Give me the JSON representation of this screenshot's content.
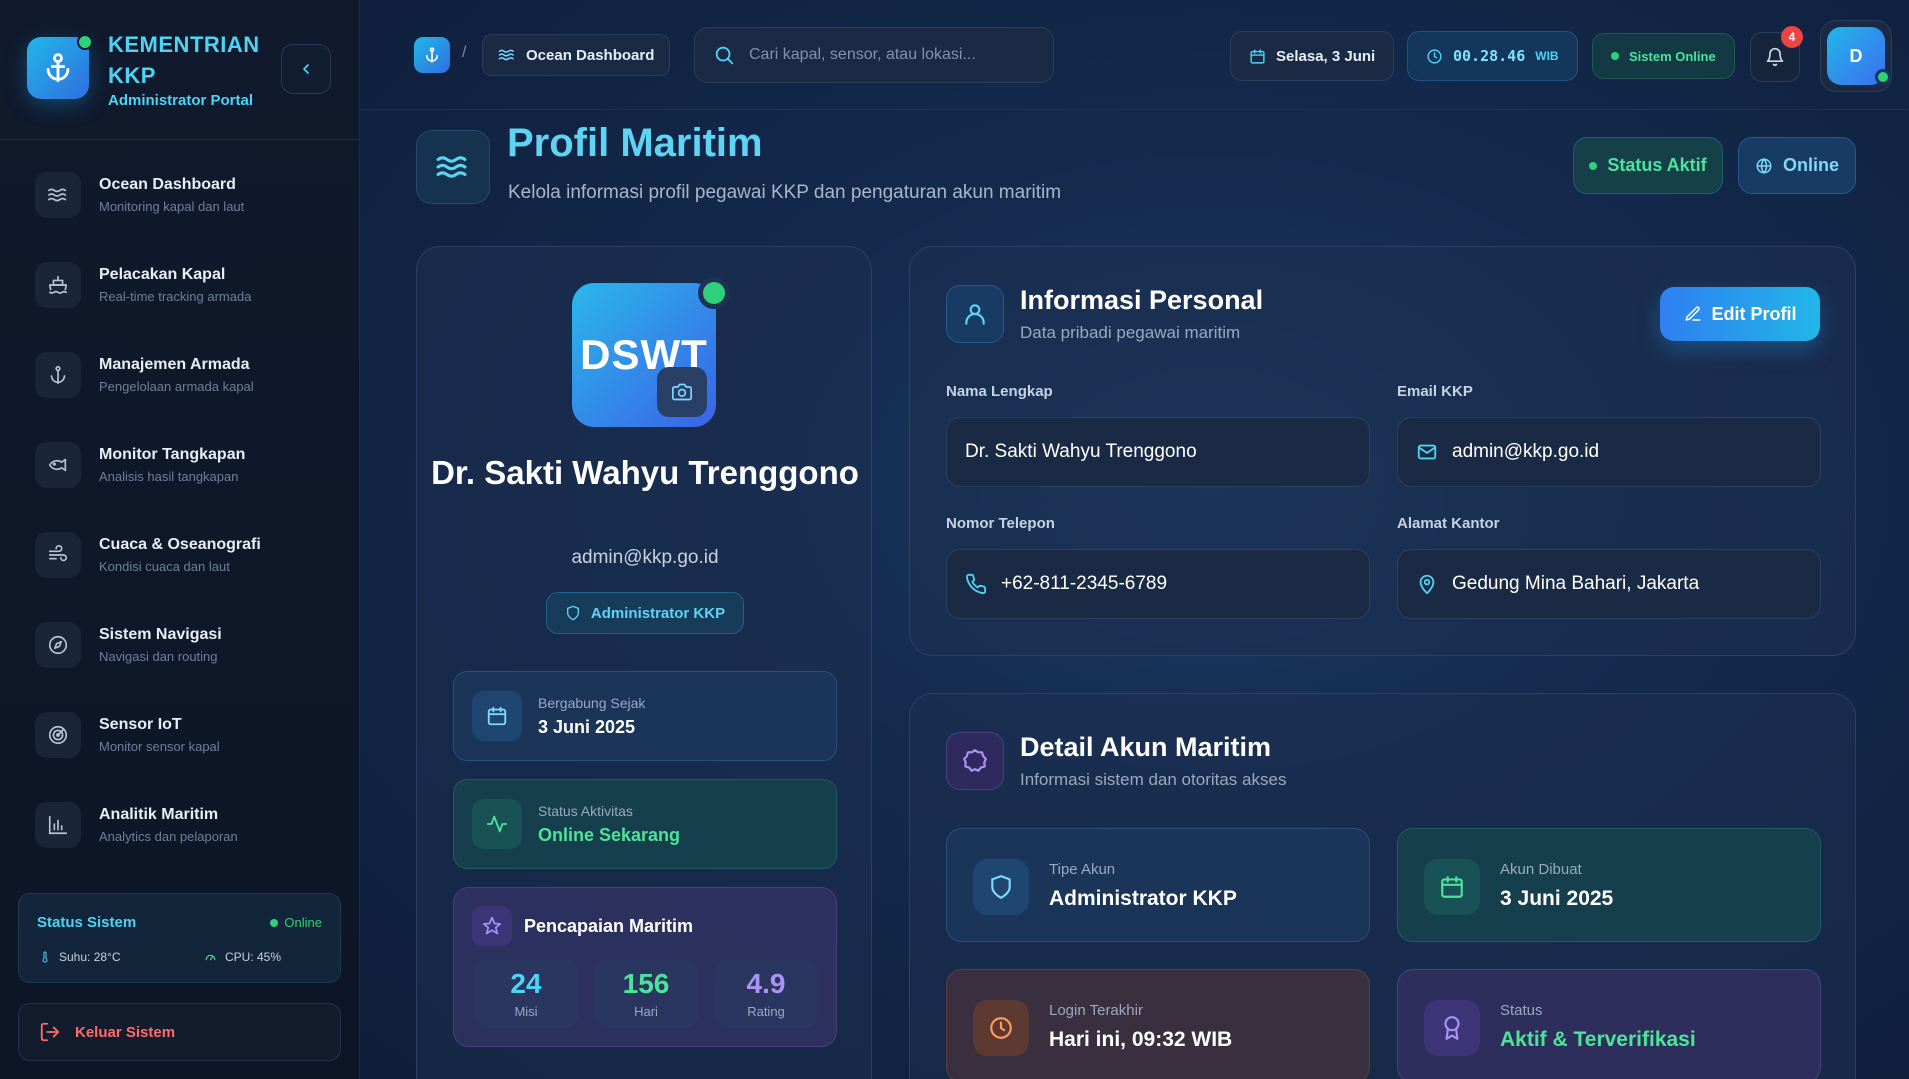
{
  "brand": {
    "title": "KEMENTRIAN KKP",
    "subtitle": "Administrator Portal"
  },
  "sidebar": {
    "items": [
      {
        "label": "Ocean Dashboard",
        "desc": "Monitoring kapal dan laut",
        "icon": "waves-icon"
      },
      {
        "label": "Pelacakan Kapal",
        "desc": "Real-time tracking armada",
        "icon": "ship-icon"
      },
      {
        "label": "Manajemen Armada",
        "desc": "Pengelolaan armada kapal",
        "icon": "anchor-icon"
      },
      {
        "label": "Monitor Tangkapan",
        "desc": "Analisis hasil tangkapan",
        "icon": "fish-icon"
      },
      {
        "label": "Cuaca & Oseanografi",
        "desc": "Kondisi cuaca dan laut",
        "icon": "wind-icon"
      },
      {
        "label": "Sistem Navigasi",
        "desc": "Navigasi dan routing",
        "icon": "compass-icon"
      },
      {
        "label": "Sensor IoT",
        "desc": "Monitor sensor kapal",
        "icon": "radar-icon"
      },
      {
        "label": "Analitik Maritim",
        "desc": "Analytics dan pelaporan",
        "icon": "bar-chart-icon"
      }
    ],
    "system_status": {
      "title": "Status Sistem",
      "state": "Online",
      "temperature": "Suhu: 28°C",
      "cpu": "CPU: 45%"
    },
    "logout_label": "Keluar Sistem"
  },
  "topbar": {
    "breadcrumb": {
      "separator": "/",
      "current": "Ocean Dashboard"
    },
    "search_placeholder": "Cari kapal, sensor, atau lokasi...",
    "date": "Selasa, 3 Juni",
    "time": "00.28.46",
    "timezone": "WIB",
    "system_status": "Sistem Online",
    "notification_count": "4",
    "user_initial": "D"
  },
  "header": {
    "title": "Profil Maritim",
    "subtitle": "Kelola informasi profil pegawai KKP dan pengaturan akun maritim",
    "status_pill": "Status Aktif",
    "online_pill": "Online"
  },
  "profile": {
    "initials": "DSWT",
    "name": "Dr. Sakti Wahyu Trenggono",
    "email": "admin@kkp.go.id",
    "role": "Administrator KKP",
    "joined_label": "Bergabung Sejak",
    "joined_value": "3 Juni 2025",
    "activity_label": "Status Aktivitas",
    "activity_value": "Online Sekarang",
    "achievements": {
      "title": "Pencapaian Maritim",
      "stats": [
        {
          "value": "24",
          "label": "Misi"
        },
        {
          "value": "156",
          "label": "Hari"
        },
        {
          "value": "4.9",
          "label": "Rating"
        }
      ]
    }
  },
  "personal": {
    "title": "Informasi Personal",
    "subtitle": "Data pribadi pegawai maritim",
    "edit_label": "Edit Profil",
    "fields": {
      "name_label": "Nama Lengkap",
      "name_value": "Dr. Sakti Wahyu Trenggono",
      "email_label": "Email KKP",
      "email_value": "admin@kkp.go.id",
      "phone_label": "Nomor Telepon",
      "phone_value": "+62-811-2345-6789",
      "address_label": "Alamat Kantor",
      "address_value": "Gedung Mina Bahari, Jakarta"
    }
  },
  "account": {
    "title": "Detail Akun Maritim",
    "subtitle": "Informasi sistem dan otoritas akses",
    "type_label": "Tipe Akun",
    "type_value": "Administrator KKP",
    "created_label": "Akun Dibuat",
    "created_value": "3 Juni 2025",
    "login_label": "Login Terakhir",
    "login_value": "Hari ini, 09:32 WIB",
    "status_label": "Status",
    "status_value": "Aktif & Terverifikasi"
  },
  "colors": {
    "accent": "#4dd4f5",
    "success": "#4ee39a",
    "danger": "#ff6b6b",
    "purple": "#a994f5"
  }
}
